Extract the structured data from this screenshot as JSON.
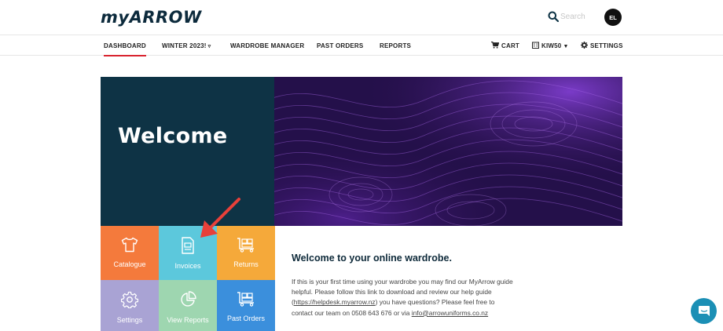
{
  "header": {
    "logo_prefix": "my",
    "logo_suffix": "ARROW",
    "search_placeholder": "Search",
    "avatar_initials": "EL"
  },
  "nav": {
    "dashboard": "DASHBOARD",
    "winter": "WINTER 2023!",
    "wardrobe_manager": "WARDROBE MANAGER",
    "past_orders": "PAST ORDERS",
    "reports": "REPORTS",
    "cart": "CART",
    "store": "KIW50",
    "settings": "SETTINGS"
  },
  "hero": {
    "title": "Welcome"
  },
  "tiles": [
    {
      "label": "Catalogue",
      "color": "#f47a3c"
    },
    {
      "label": "Invoices",
      "color": "#5cc8dc"
    },
    {
      "label": "Returns",
      "color": "#f5a93a"
    },
    {
      "label": "Settings",
      "color": "#a9a3d4"
    },
    {
      "label": "View Reports",
      "color": "#9ed6b0"
    },
    {
      "label": "Past Orders",
      "color": "#3b8fdc"
    }
  ],
  "info": {
    "title": "Welcome to your online wardrobe.",
    "text_1": "If this is your first time using your wardrobe you may find our MyArrow guide helpful. Please follow this link to download and review our help guide (",
    "link_1": "https://helpdesk.myarrow.nz",
    "text_2": ") you have questions? Please feel free to contact our team on 0508 643 676 or via ",
    "link_2": "info@arrowuniforms.co.nz"
  },
  "colors": {
    "navy": "#0e3345",
    "active_underline": "#d9232e",
    "annotation_arrow": "#e8403a",
    "chat": "#1b8fb5"
  }
}
